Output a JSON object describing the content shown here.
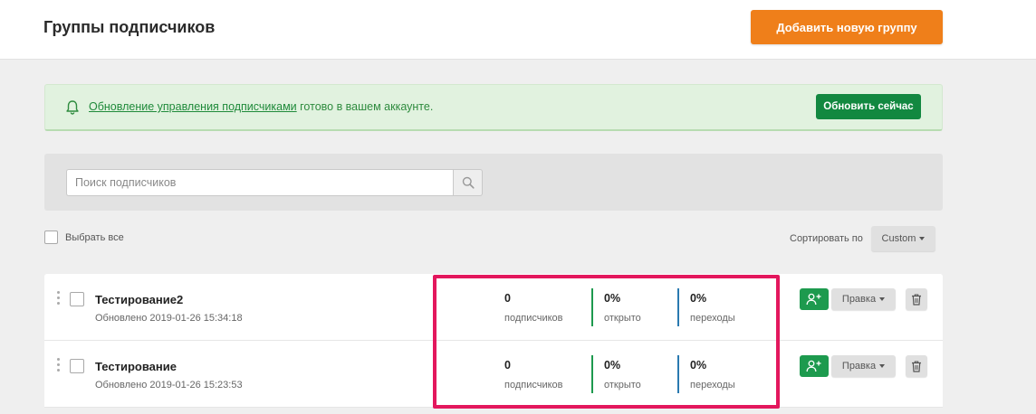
{
  "header": {
    "title": "Группы подписчиков",
    "add_group_label": "Добавить новую группу"
  },
  "notice": {
    "link_text": "Обновление управления подписчиками",
    "text": " готово в вашем аккаунте.",
    "button_label": "Обновить сейчас"
  },
  "search": {
    "placeholder": "Поиск подписчиков"
  },
  "list_controls": {
    "select_all_label": "Выбрать все",
    "sort_label": "Сортировать по",
    "sort_value": "Custom"
  },
  "groups": [
    {
      "name": "Тестирование2",
      "updated": "Обновлено 2019-01-26 15:34:18",
      "subscribers": "0",
      "subscribers_label": "подписчиков",
      "opened": "0%",
      "opened_label": "открыто",
      "clicks": "0%",
      "clicks_label": "переходы",
      "edit_label": "Правка"
    },
    {
      "name": "Тестирование",
      "updated": "Обновлено 2019-01-26 15:23:53",
      "subscribers": "0",
      "subscribers_label": "подписчиков",
      "opened": "0%",
      "opened_label": "открыто",
      "clicks": "0%",
      "clicks_label": "переходы",
      "edit_label": "Правка"
    }
  ],
  "icons": {
    "notice": "bell-icon",
    "search": "search-icon",
    "add_subscriber": "add-user-icon",
    "delete": "trash-icon",
    "drag": "drag-handle-icon"
  },
  "colors": {
    "primary_orange": "#ef7f1a",
    "success_green": "#128840",
    "notice_background": "#e1f2df",
    "highlight": "#e3175d"
  }
}
